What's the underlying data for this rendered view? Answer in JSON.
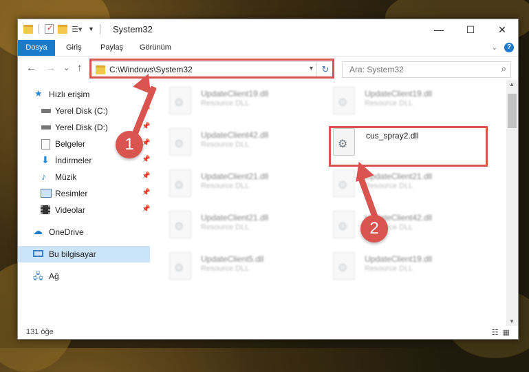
{
  "window": {
    "title": "System32",
    "minimize": "—",
    "maximize": "☐",
    "close": "✕"
  },
  "ribbon": {
    "tabs": [
      {
        "label": "Dosya",
        "active": true
      },
      {
        "label": "Giriş"
      },
      {
        "label": "Paylaş"
      },
      {
        "label": "Görünüm"
      }
    ],
    "help": "?"
  },
  "address": {
    "path": "C:\\Windows\\System32",
    "back": "←",
    "forward": "→",
    "recent": "⌄",
    "up": "↑",
    "refresh": "↻"
  },
  "search": {
    "placeholder": "Ara: System32"
  },
  "sidebar": {
    "items": [
      {
        "label": "Hızlı erişim",
        "icon": "star-icon"
      },
      {
        "label": "Yerel Disk (C:)",
        "icon": "drive-icon",
        "pinned": true
      },
      {
        "label": "Yerel Disk (D:)",
        "icon": "drive-icon",
        "pinned": true
      },
      {
        "label": "Belgeler",
        "icon": "documents-icon",
        "pinned": true
      },
      {
        "label": "İndirmeler",
        "icon": "download-icon",
        "pinned": true
      },
      {
        "label": "Müzik",
        "icon": "music-icon",
        "pinned": true
      },
      {
        "label": "Resimler",
        "icon": "pictures-icon",
        "pinned": true
      },
      {
        "label": "Videolar",
        "icon": "video-icon",
        "pinned": true
      },
      {
        "label": "OneDrive",
        "icon": "cloud-icon"
      },
      {
        "label": "Bu bilgisayar",
        "icon": "computer-icon",
        "selected": true
      },
      {
        "label": "Ağ",
        "icon": "network-icon"
      }
    ]
  },
  "files": [
    {
      "name": "UpdateClient19.dll",
      "desc": "Resource DLL",
      "blur": true
    },
    {
      "name": "UpdateClient19.dll",
      "desc": "Resource DLL",
      "blur": true
    },
    {
      "name": "UpdateClient42.dll",
      "desc": "Resource DLL",
      "blur": true
    },
    {
      "name": "cus_spray2.dll",
      "desc": "",
      "blur": false
    },
    {
      "name": "UpdateClient21.dll",
      "desc": "Resource DLL",
      "blur": true
    },
    {
      "name": "UpdateClient21.dll",
      "desc": "Resource DLL",
      "blur": true
    },
    {
      "name": "UpdateClient21.dll",
      "desc": "Resource DLL",
      "blur": true
    },
    {
      "name": "UpdateClient42.dll",
      "desc": "Resource DLL",
      "blur": true
    },
    {
      "name": "UpdateClient5.dll",
      "desc": "Resource DLL",
      "blur": true
    },
    {
      "name": "UpdateClient19.dll",
      "desc": "Resource DLL",
      "blur": true
    }
  ],
  "status": {
    "count": "131 öğe"
  },
  "annotations": {
    "badge1": "1",
    "badge2": "2",
    "color": "#d9534f"
  }
}
